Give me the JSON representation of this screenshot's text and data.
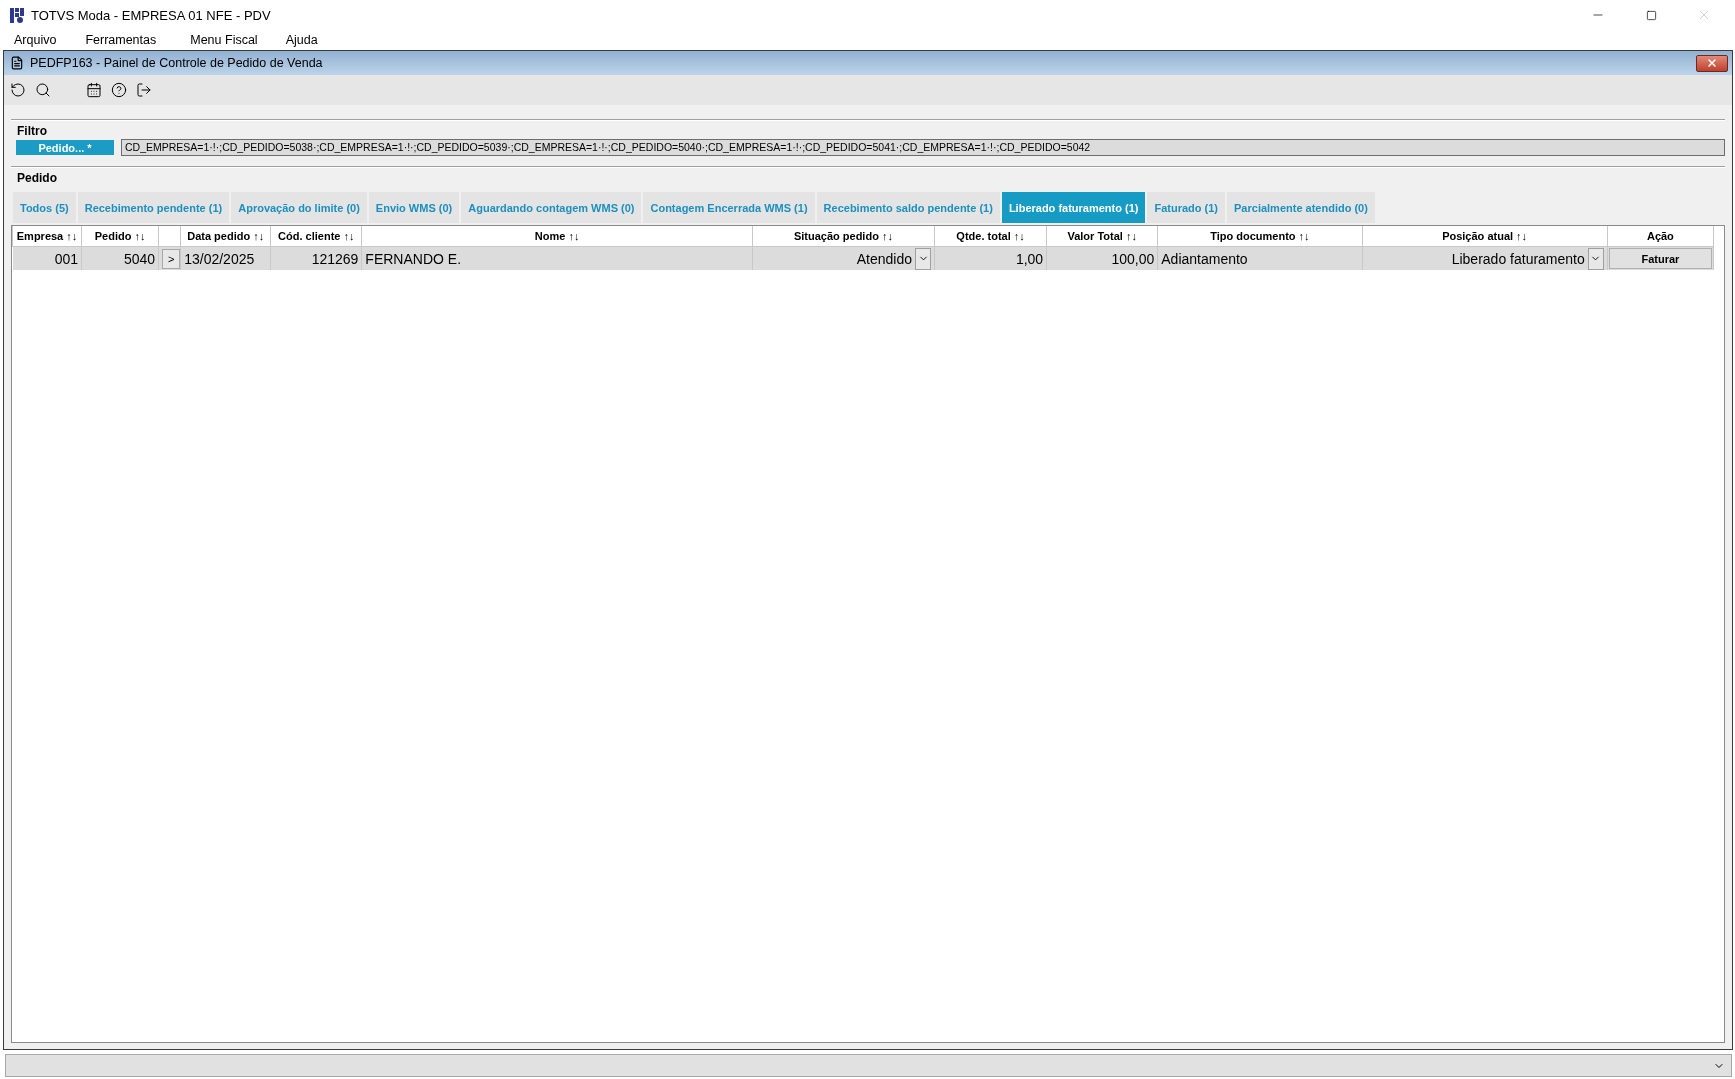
{
  "window": {
    "title": "TOTVS Moda - EMPRESA 01 NFE - PDV"
  },
  "menu": [
    {
      "label": "Arquivo"
    },
    {
      "label": "Ferramentas"
    },
    {
      "label": "Menu Fiscal"
    },
    {
      "label": "Ajuda"
    }
  ],
  "child_window": {
    "title": "PEDFP163 - Painel de Controle de Pedido de Venda"
  },
  "filter": {
    "heading": "Filtro",
    "button": "Pedido... *",
    "value": "CD_EMPRESA=1·!·;CD_PEDIDO=5038·;CD_EMPRESA=1·!·;CD_PEDIDO=5039·;CD_EMPRESA=1·!·;CD_PEDIDO=5040·;CD_EMPRESA=1·!·;CD_PEDIDO=5041·;CD_EMPRESA=1·!·;CD_PEDIDO=5042"
  },
  "section": {
    "heading": "Pedido"
  },
  "tabs": [
    {
      "label": "Todos (5)",
      "selected": false
    },
    {
      "label": "Recebimento pendente (1)",
      "selected": false
    },
    {
      "label": "Aprovação do limite (0)",
      "selected": false
    },
    {
      "label": "Envio WMS (0)",
      "selected": false
    },
    {
      "label": "Aguardando contagem WMS (0)",
      "selected": false
    },
    {
      "label": "Contagem Encerrada WMS (1)",
      "selected": false
    },
    {
      "label": "Recebimento saldo pendente (1)",
      "selected": false
    },
    {
      "label": "Liberado faturamento (1)",
      "selected": true
    },
    {
      "label": "Faturado (1)",
      "selected": false
    },
    {
      "label": "Parcialmente atendido (0)",
      "selected": false
    }
  ],
  "table": {
    "columns": [
      {
        "kind": "sortable",
        "label": "Empresa",
        "sort": "↑↓"
      },
      {
        "kind": "sortable",
        "label": "Pedido",
        "sort": "↑↓"
      },
      {
        "kind": "blank"
      },
      {
        "kind": "sortable",
        "label": "Data pedido",
        "sort": "↑↓"
      },
      {
        "kind": "sortable",
        "label": "Cód. cliente",
        "sort": "↑↓"
      },
      {
        "kind": "sortable",
        "label": "Nome",
        "sort": "↑↓"
      },
      {
        "kind": "sortable",
        "label": "Situação pedido",
        "sort": "↑↓"
      },
      {
        "kind": "sortable",
        "label": "Qtde. total",
        "sort": "↑↓"
      },
      {
        "kind": "sortable",
        "label": "Valor Total",
        "sort": "↑↓"
      },
      {
        "kind": "sortable",
        "label": "Tipo documento",
        "sort": "↑↓"
      },
      {
        "kind": "sortable",
        "label": "Posição atual",
        "sort": "↑↓"
      },
      {
        "kind": "plain",
        "label": "Ação"
      }
    ],
    "rows": [
      {
        "cells": [
          {
            "kind": "text",
            "text": "001"
          },
          {
            "kind": "text",
            "text": "5040"
          },
          {
            "kind": "expand",
            "text": ">"
          },
          {
            "kind": "text",
            "text": "13/02/2025"
          },
          {
            "kind": "text",
            "text": "121269"
          },
          {
            "kind": "text",
            "text": "FERNANDO E."
          },
          {
            "kind": "select",
            "text": "Atendido"
          },
          {
            "kind": "text",
            "text": "1,00"
          },
          {
            "kind": "text",
            "text": "100,00"
          },
          {
            "kind": "text",
            "text": "Adiantamento"
          },
          {
            "kind": "select",
            "text": "Liberado faturamento"
          },
          {
            "kind": "button",
            "text": "Faturar"
          }
        ]
      }
    ]
  }
}
